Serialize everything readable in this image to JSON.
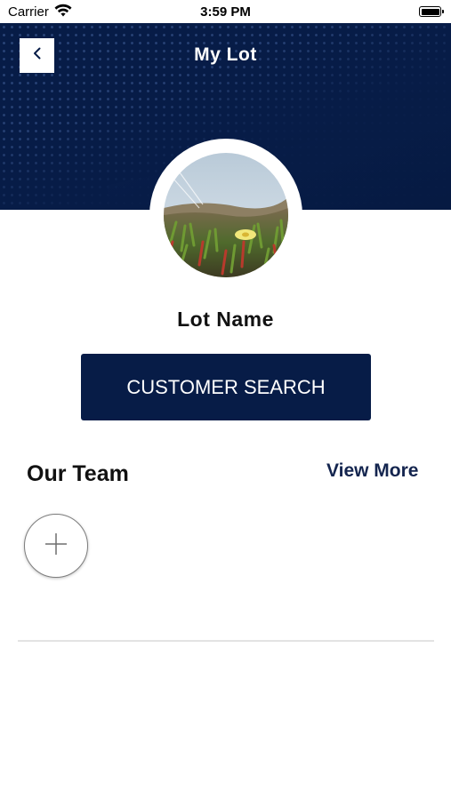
{
  "status_bar": {
    "carrier": "Carrier",
    "time": "3:59 PM"
  },
  "header": {
    "title": "My Lot",
    "back_icon": "chevron-left-icon"
  },
  "profile": {
    "lot_name": "Lot Name"
  },
  "actions": {
    "customer_search_label": "CUSTOMER SEARCH"
  },
  "team": {
    "title": "Our Team",
    "view_more_label": "View More",
    "add_icon": "plus-icon"
  },
  "colors": {
    "brand_navy": "#071c47",
    "link_navy": "#14254f"
  }
}
